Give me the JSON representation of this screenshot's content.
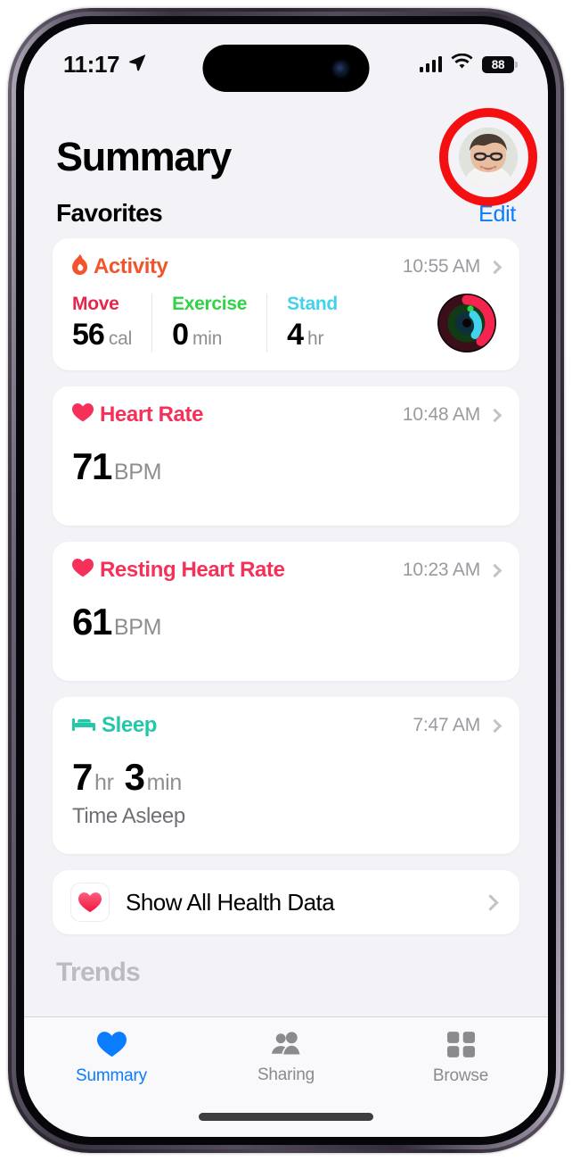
{
  "status_bar": {
    "time": "11:17",
    "location_icon": "location-arrow-icon",
    "signal_icon": "cellular-bars-icon",
    "wifi_icon": "wifi-icon",
    "battery_percent": "88"
  },
  "header": {
    "title": "Summary",
    "avatar_name": "profile-avatar",
    "annotation": "red-highlight-ring"
  },
  "favorites": {
    "section_title": "Favorites",
    "edit_label": "Edit"
  },
  "cards": [
    {
      "id": "activity",
      "label": "Activity",
      "icon": "flame-icon",
      "color": "#f2552c",
      "time": "10:55 AM",
      "metrics": [
        {
          "name": "Move",
          "label_color": "#e8264c",
          "value": "56",
          "unit": "cal"
        },
        {
          "name": "Exercise",
          "label_color": "#2fd345",
          "value": "0",
          "unit": "min"
        },
        {
          "name": "Stand",
          "label_color": "#42d2ec",
          "value": "4",
          "unit": "hr"
        }
      ],
      "rings_icon": "activity-rings-icon"
    },
    {
      "id": "heart-rate",
      "label": "Heart Rate",
      "icon": "heart-icon",
      "color": "#f5315a",
      "time": "10:48 AM",
      "value": "71",
      "unit": "BPM"
    },
    {
      "id": "resting-heart-rate",
      "label": "Resting Heart Rate",
      "icon": "heart-icon",
      "color": "#f5315a",
      "time": "10:23 AM",
      "value": "61",
      "unit": "BPM"
    },
    {
      "id": "sleep",
      "label": "Sleep",
      "icon": "bed-icon",
      "color": "#23c8ab",
      "time": "7:47 AM",
      "value_hr": "7",
      "unit_hr": "hr",
      "value_min": "3",
      "unit_min": "min",
      "subtitle": "Time Asleep"
    }
  ],
  "show_all": {
    "label": "Show All Health Data",
    "icon": "health-heart-app-icon"
  },
  "next_section_peek": "Trends",
  "tab_bar": {
    "tabs": [
      {
        "label": "Summary",
        "icon": "heart-filled-icon",
        "active": true
      },
      {
        "label": "Sharing",
        "icon": "people-icon",
        "active": false
      },
      {
        "label": "Browse",
        "icon": "grid-icon",
        "active": false
      }
    ],
    "active_color": "#0a7cff",
    "inactive_color": "#8a8a8f"
  }
}
